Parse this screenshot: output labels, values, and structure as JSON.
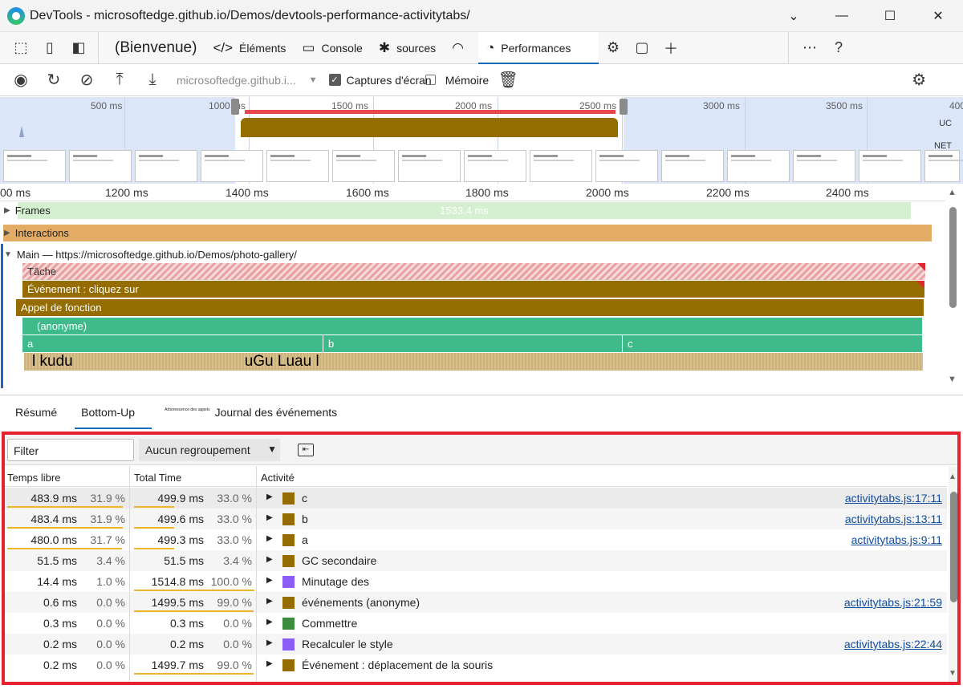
{
  "window": {
    "title": "DevTools - microsoftedge.github.io/Demos/devtools-performance-activitytabs/",
    "minimize": "—",
    "maximize": "☐",
    "close": "✕",
    "dropdown": "⌄"
  },
  "tabs": {
    "welcome": "(Bienvenue)",
    "elements": "Éléments",
    "console": "Console",
    "sources": "sources",
    "performance": "Performances"
  },
  "perf_toolbar": {
    "url": "microsoftedge.github.i...",
    "screenshots_label": "Captures d'écran",
    "screenshots_checked": true,
    "memory_label": "Mémoire",
    "memory_checked": false
  },
  "overview": {
    "ticks": [
      "500 ms",
      "1000 ms",
      "1500 ms",
      "2000 ms",
      "2500 ms",
      "3000 ms",
      "3500 ms",
      "400"
    ],
    "cpu_label": "UC",
    "net_label": "NET"
  },
  "timeline": {
    "ticks": [
      "00 ms",
      "1200 ms",
      "1400 ms",
      "1600 ms",
      "1800 ms",
      "2000 ms",
      "2200 ms",
      "2400 ms"
    ],
    "frames_label": "Frames",
    "frames_duration": "1533.4 ms",
    "interactions_label": "Interactions",
    "main_label": "Main — https://microsoftedge.github.io/Demos/photo-gallery/",
    "task": "Tâche",
    "event": "Événement : cliquez sur",
    "function_call": "Appel de fonction",
    "anonymous": "(anonyme)",
    "a": "a",
    "b": "b",
    "c": "c",
    "small1": "l kudu",
    "small2": "uGu Luau l"
  },
  "bottom_tabs": {
    "summary": "Résumé",
    "bottom_up": "Bottom-Up",
    "call_tree": "Arborescence des appels",
    "event_log": "Journal des événements"
  },
  "filter": {
    "placeholder": "Filter",
    "grouping": "Aucun regroupement"
  },
  "grid": {
    "headers": {
      "self_time": "Temps libre",
      "total_time": "Total Time",
      "activity": "Activité"
    },
    "rows": [
      {
        "self": "483.9 ms",
        "self_pct": "31.9 %",
        "self_frac": 0.319,
        "total": "499.9 ms",
        "total_pct": "33.0 %",
        "total_frac": 0.33,
        "activity": "c",
        "color": "#956c00",
        "link": "activitytabs.js:17:11"
      },
      {
        "self": "483.4 ms",
        "self_pct": "31.9 %",
        "self_frac": 0.319,
        "total": "499.6 ms",
        "total_pct": "33.0 %",
        "total_frac": 0.33,
        "activity": "b",
        "color": "#956c00",
        "link": "activitytabs.js:13:11"
      },
      {
        "self": "480.0 ms",
        "self_pct": "31.7 %",
        "self_frac": 0.317,
        "total": "499.3 ms",
        "total_pct": "33.0 %",
        "total_frac": 0.33,
        "activity": "a",
        "color": "#956c00",
        "link": "activitytabs.js:9:11"
      },
      {
        "self": "51.5 ms",
        "self_pct": "3.4 %",
        "self_frac": 0,
        "total": "51.5 ms",
        "total_pct": "3.4 %",
        "total_frac": 0,
        "activity": "GC secondaire",
        "color": "#956c00",
        "link": ""
      },
      {
        "self": "14.4 ms",
        "self_pct": "1.0 %",
        "self_frac": 0,
        "total": "1514.8 ms",
        "total_pct": "100.0 %",
        "total_frac": 1.0,
        "activity": "Minutage des",
        "color": "#8b5cf6",
        "link": ""
      },
      {
        "self": "0.6 ms",
        "self_pct": "0.0 %",
        "self_frac": 0,
        "total": "1499.5 ms",
        "total_pct": "99.0 %",
        "total_frac": 0.99,
        "activity": "événements (anonyme)",
        "color": "#956c00",
        "link": "activitytabs.js:21:59"
      },
      {
        "self": "0.3 ms",
        "self_pct": "0.0 %",
        "self_frac": 0,
        "total": "0.3 ms",
        "total_pct": "0.0 %",
        "total_frac": 0,
        "activity": "Commettre",
        "color": "#3d8b3d",
        "link": ""
      },
      {
        "self": "0.2 ms",
        "self_pct": "0.0 %",
        "self_frac": 0,
        "total": "0.2 ms",
        "total_pct": "0.0 %",
        "total_frac": 0,
        "activity": "Recalculer le style",
        "color": "#8b5cf6",
        "link": "activitytabs.js:22:44"
      },
      {
        "self": "0.2 ms",
        "self_pct": "0.0 %",
        "self_frac": 0,
        "total": "1499.7 ms",
        "total_pct": "99.0 %",
        "total_frac": 0.99,
        "activity": "Événement : déplacement de la souris",
        "color": "#956c00",
        "link": ""
      }
    ]
  }
}
